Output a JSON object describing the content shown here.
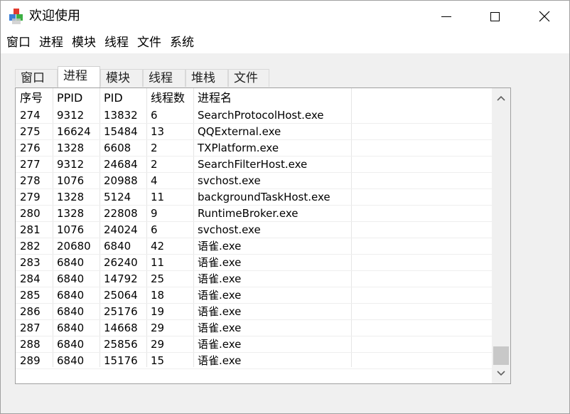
{
  "window": {
    "title": "欢迎使用"
  },
  "menu": [
    "窗口",
    "进程",
    "模块",
    "线程",
    "文件",
    "系统"
  ],
  "tabs": [
    {
      "label": "窗口",
      "active": false
    },
    {
      "label": "进程",
      "active": true
    },
    {
      "label": "模块",
      "active": false
    },
    {
      "label": "线程",
      "active": false
    },
    {
      "label": "堆栈",
      "active": false
    },
    {
      "label": "文件",
      "active": false
    }
  ],
  "table": {
    "columns": [
      "序号",
      "PPID",
      "PID",
      "线程数",
      "进程名"
    ],
    "rows": [
      [
        "274",
        "9312",
        "13832",
        "6",
        "SearchProtocolHost.exe"
      ],
      [
        "275",
        "16624",
        "15484",
        "13",
        "QQExternal.exe"
      ],
      [
        "276",
        "1328",
        "6608",
        "2",
        "TXPlatform.exe"
      ],
      [
        "277",
        "9312",
        "24684",
        "2",
        "SearchFilterHost.exe"
      ],
      [
        "278",
        "1076",
        "20988",
        "4",
        "svchost.exe"
      ],
      [
        "279",
        "1328",
        "5124",
        "11",
        "backgroundTaskHost.exe"
      ],
      [
        "280",
        "1328",
        "22808",
        "9",
        "RuntimeBroker.exe"
      ],
      [
        "281",
        "1076",
        "24024",
        "6",
        "svchost.exe"
      ],
      [
        "282",
        "20680",
        "6840",
        "42",
        "语雀.exe"
      ],
      [
        "283",
        "6840",
        "26240",
        "11",
        "语雀.exe"
      ],
      [
        "284",
        "6840",
        "14792",
        "25",
        "语雀.exe"
      ],
      [
        "285",
        "6840",
        "25064",
        "18",
        "语雀.exe"
      ],
      [
        "286",
        "6840",
        "25176",
        "19",
        "语雀.exe"
      ],
      [
        "287",
        "6840",
        "14668",
        "29",
        "语雀.exe"
      ],
      [
        "288",
        "6840",
        "25856",
        "29",
        "语雀.exe"
      ],
      [
        "289",
        "6840",
        "15176",
        "15",
        "语雀.exe"
      ]
    ]
  },
  "icons": {
    "app": "app-cubes-icon",
    "minimize": "minimize-icon",
    "maximize": "maximize-icon",
    "close": "close-icon",
    "scroll_up": "chevron-up-icon",
    "scroll_down": "chevron-down-icon"
  },
  "colors": {
    "window_bg": "#f0f0f0",
    "list_bg": "#ffffff",
    "thumb": "#c8c8c8"
  }
}
